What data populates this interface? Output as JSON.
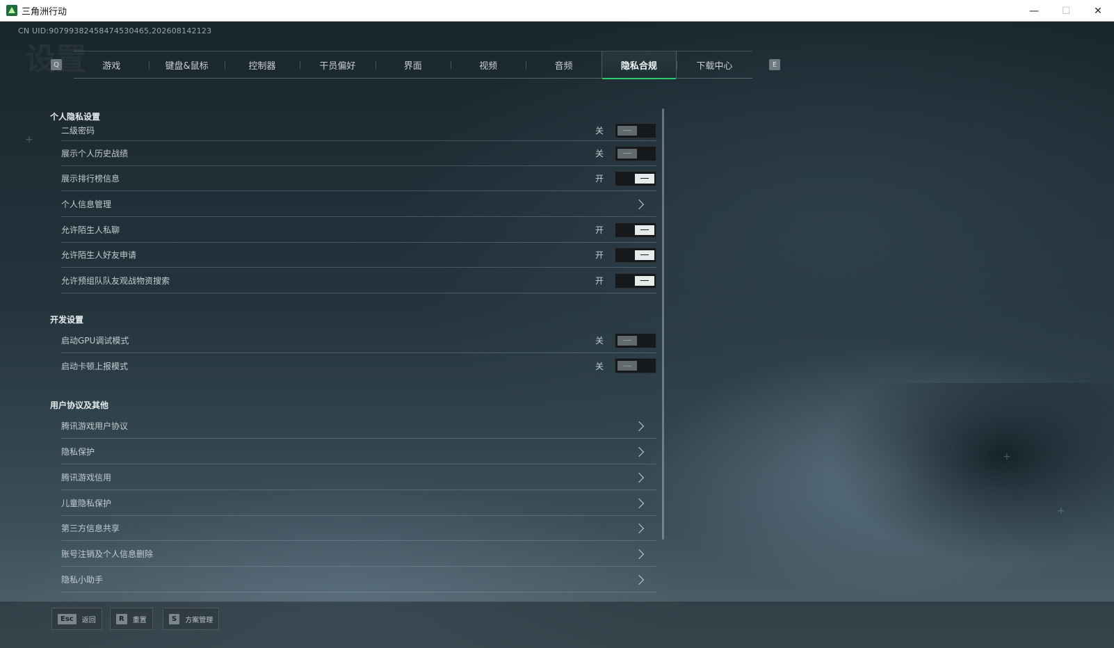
{
  "window": {
    "title": "三角洲行动",
    "minimize": "—",
    "maximize": "☐",
    "close": "✕"
  },
  "uid": "CN UID:9079938245847453046​5,202608142123",
  "ghost_title": "设置",
  "tabs": {
    "prev_key": "Q",
    "next_key": "E",
    "items": [
      {
        "label": "游戏"
      },
      {
        "label": "键盘&鼠标"
      },
      {
        "label": "控制器"
      },
      {
        "label": "干员偏好"
      },
      {
        "label": "界面"
      },
      {
        "label": "视频"
      },
      {
        "label": "音频"
      },
      {
        "label": "隐私合规"
      },
      {
        "label": "下载中心"
      }
    ],
    "active_index": 7
  },
  "sections": {
    "privacy": {
      "title": "个人隐私设置",
      "rows": [
        {
          "label": "二级密码",
          "state": "关",
          "on": false
        },
        {
          "label": "展示个人历史战绩",
          "state": "关",
          "on": false
        },
        {
          "label": "展示排行榜信息",
          "state": "开",
          "on": true
        },
        {
          "label": "个人信息管理"
        },
        {
          "label": "允许陌生人私聊",
          "state": "开",
          "on": true
        },
        {
          "label": "允许陌生人好友申请",
          "state": "开",
          "on": true
        },
        {
          "label": "允许预组队队友观战物资搜索",
          "state": "开",
          "on": true
        }
      ]
    },
    "dev": {
      "title": "开发设置",
      "rows": [
        {
          "label": "启动GPU调试模式",
          "state": "关",
          "on": false
        },
        {
          "label": "启动卡顿上报模式",
          "state": "关",
          "on": false
        }
      ]
    },
    "agreements": {
      "title": "用户协议及其他",
      "rows": [
        {
          "label": "腾讯游戏用户协议"
        },
        {
          "label": "隐私保护"
        },
        {
          "label": "腾讯游戏信用"
        },
        {
          "label": "儿童隐私保护"
        },
        {
          "label": "第三方信息共享"
        },
        {
          "label": "账号注销及个人信息删除"
        },
        {
          "label": "隐私小助手"
        }
      ]
    }
  },
  "bottom": {
    "back": {
      "key": "Esc",
      "label": "返回"
    },
    "reset": {
      "key": "R",
      "label": "重置"
    },
    "scheme": {
      "key": "S",
      "label": "方案管理"
    }
  }
}
